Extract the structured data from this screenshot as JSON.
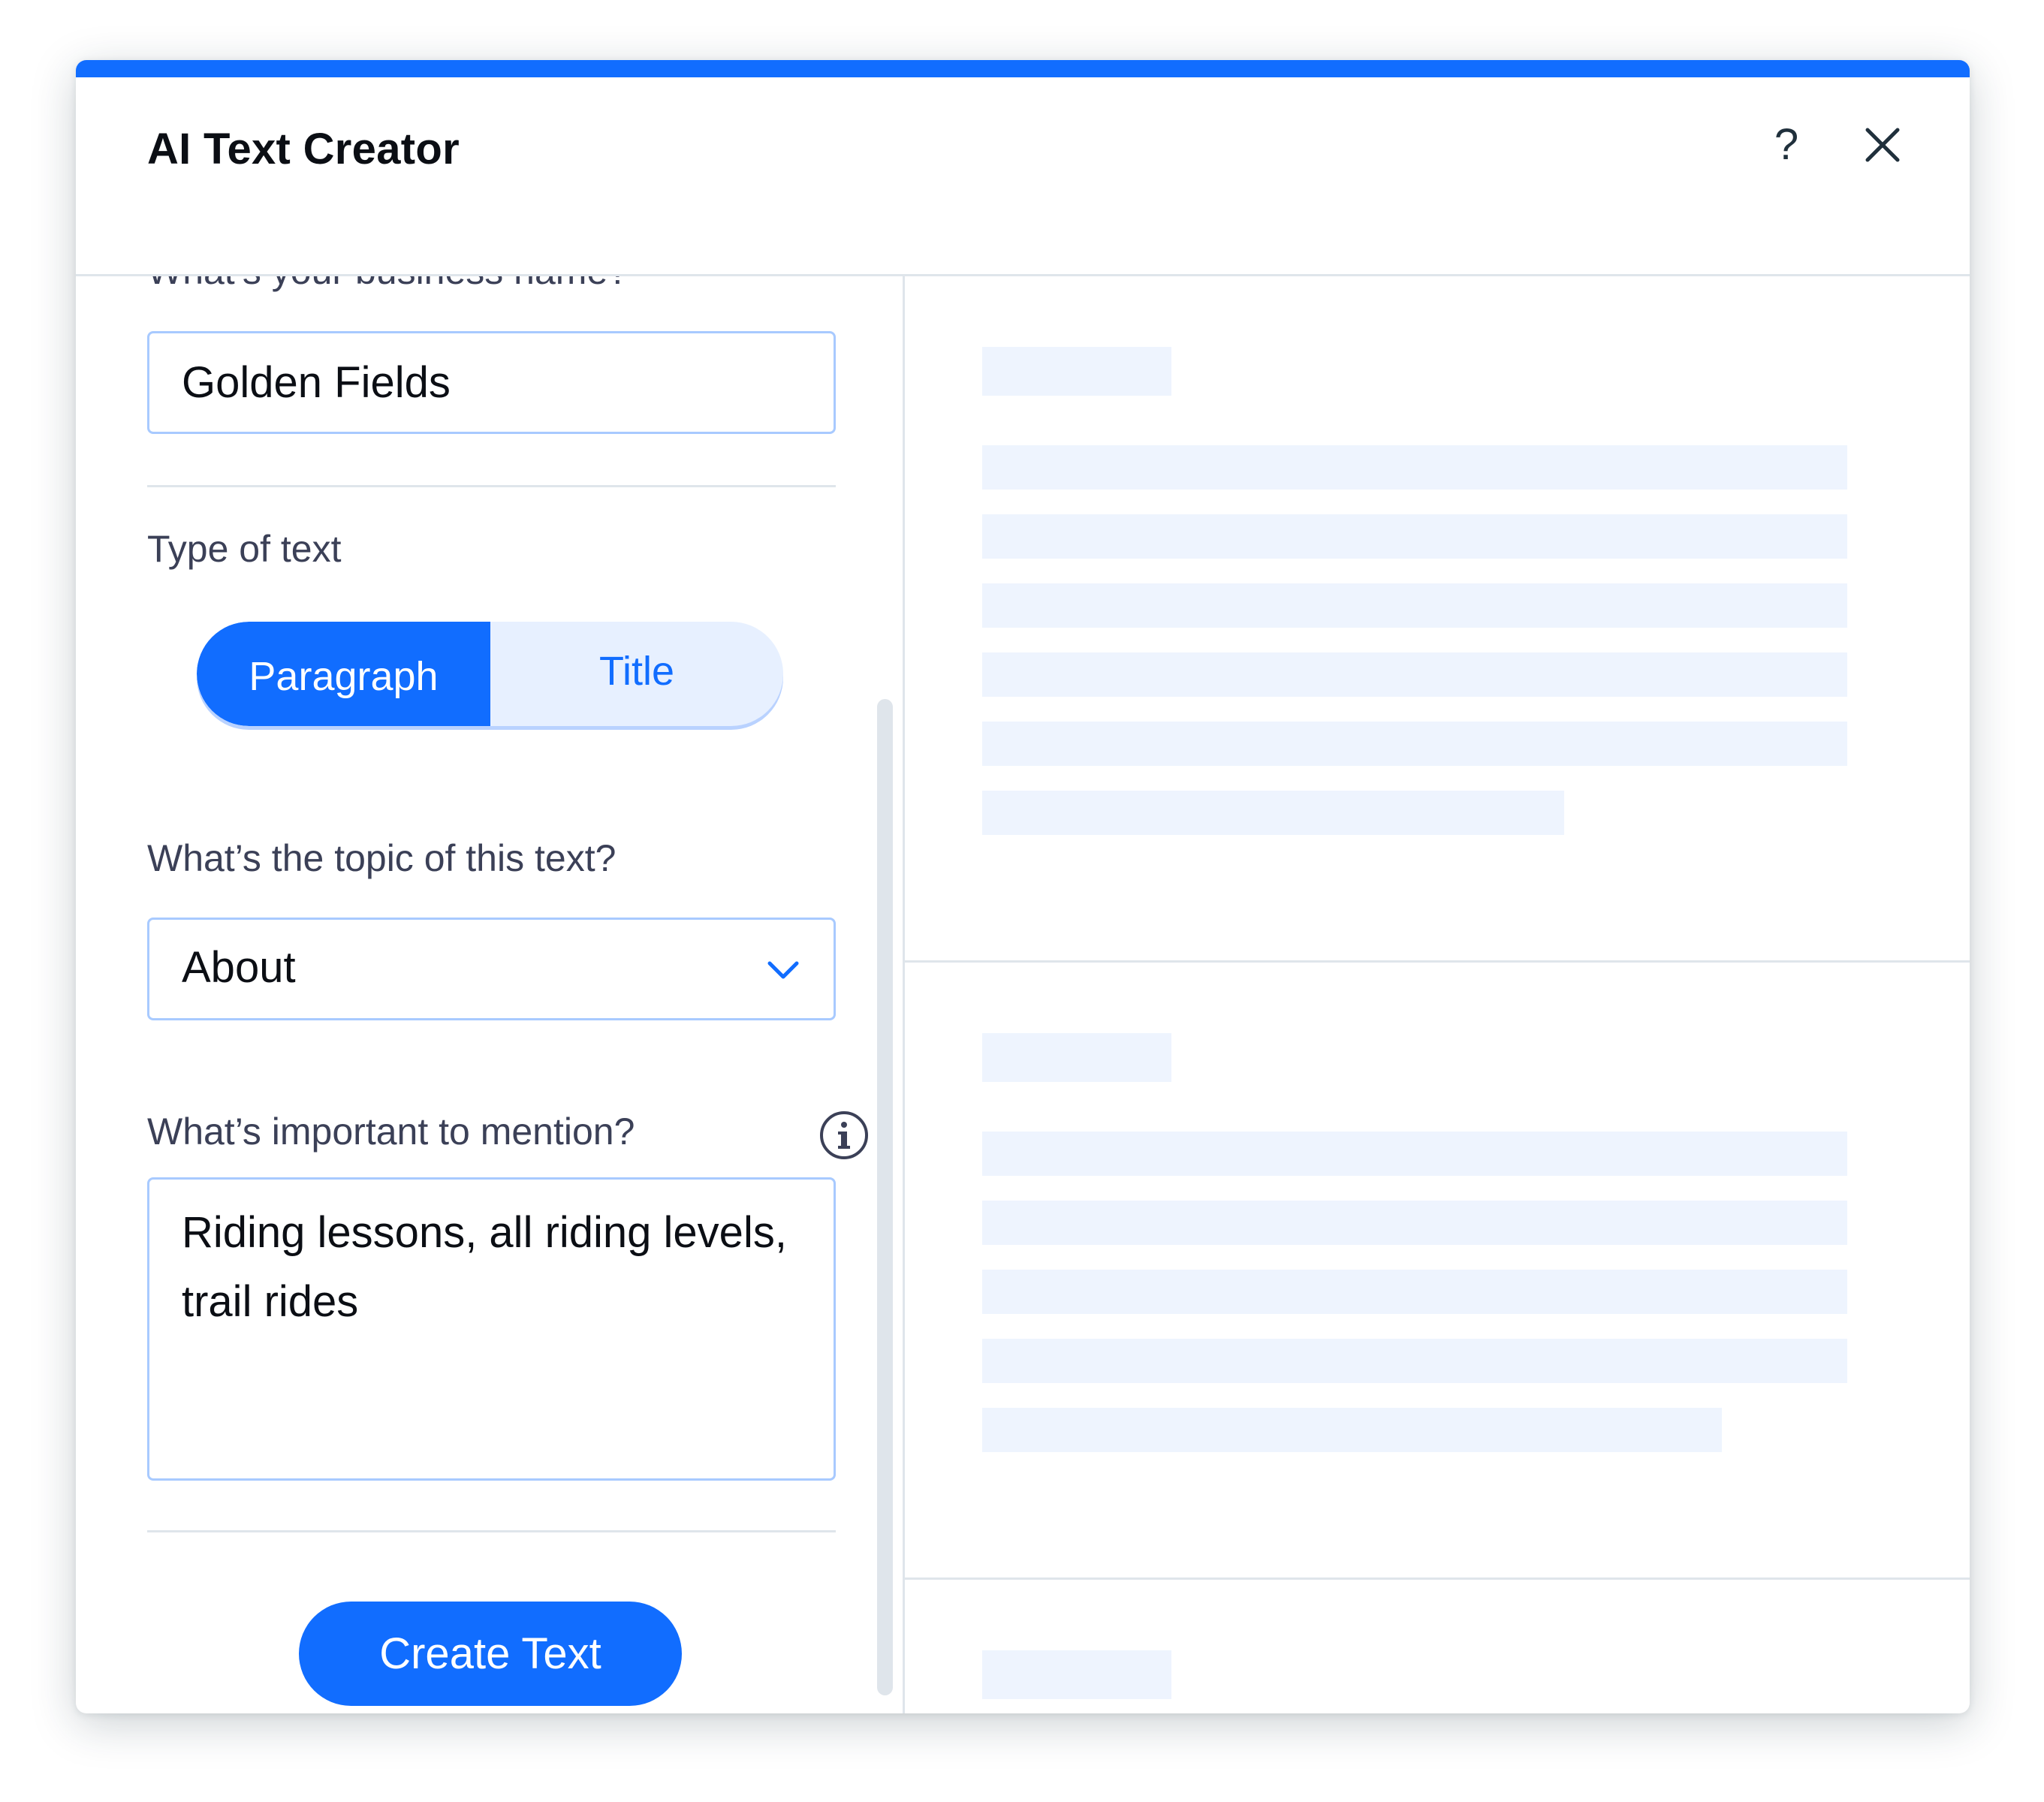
{
  "dialog": {
    "title": "AI Text Creator",
    "help_label": "?",
    "accent_color": "#116dff"
  },
  "form": {
    "business_name_label": "What’s your business name?",
    "business_name_value": "Golden Fields",
    "type_label": "Type of text",
    "type_options": [
      "Paragraph",
      "Title"
    ],
    "type_selected": "Paragraph",
    "topic_label": "What’s the topic of this text?",
    "topic_value": "About",
    "mention_label": "What’s important to mention?",
    "mention_value": "Riding lessons, all riding levels, trail rides",
    "create_button": "Create Text"
  },
  "icons": {
    "help": "question-mark-icon",
    "close": "close-icon",
    "dropdown": "chevron-down-icon",
    "info": "info-icon"
  },
  "preview": {
    "state": "loading placeholders"
  }
}
